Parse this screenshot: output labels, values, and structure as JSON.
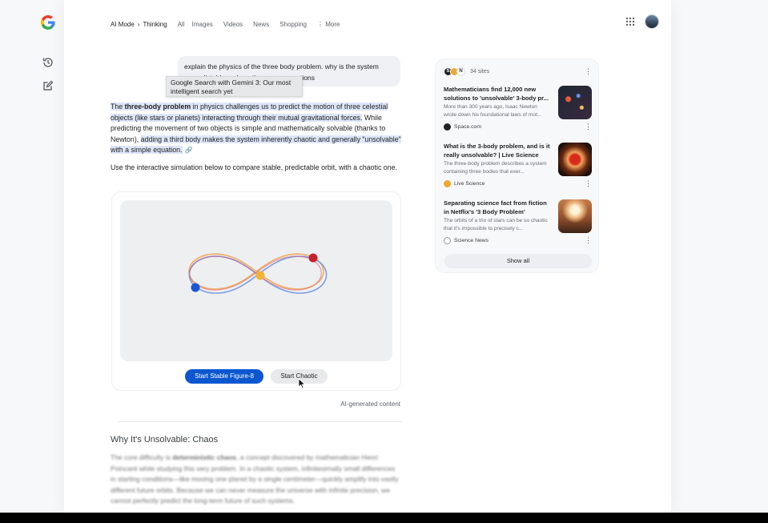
{
  "nav": {
    "crumb_mode": "AI Mode",
    "crumb_sep": "›",
    "crumb_current": "Thinking",
    "tabs": [
      "All",
      "Images",
      "Videos",
      "News",
      "Shopping"
    ],
    "more_label": "More"
  },
  "query": {
    "text_line1": "explain the physics of the three body problem. why is the system",
    "text_line2": "unpredictable and are there any exceptions"
  },
  "tooltip": {
    "line1": "Google Search with Gemini 3: Our most",
    "line2": "intelligent search yet"
  },
  "answer": {
    "p1_a": "The ",
    "p1_bold": "three-body problem",
    "p1_b": " in physics challenges us to predict the motion of three celestial objects (like stars or planets) interacting through their mutual gravitational forces.",
    "p1_c": " While predicting the movement of two objects is simple and mathematically solvable (thanks to Newton), ",
    "p1_d": "adding a third body makes the system inherently chaotic and generally \"unsolvable\" with a simple equation.",
    "intro": "Use the interactive simulation below to compare stable, predictable orbit, with a chaotic one."
  },
  "simulation": {
    "stable_button": "Start Stable Figure-8",
    "chaotic_button": "Start Chaotic",
    "body_colors": [
      "#1a56d6",
      "#f2b233",
      "#c5222d"
    ],
    "path_colors": [
      "#f0a24a",
      "#6a8fe0",
      "#e06070"
    ]
  },
  "ai_note": "AI-generated content",
  "section": {
    "title": "Why It's Unsolvable: Chaos",
    "body_a": "The core difficulty is ",
    "body_bold": "deterministic chaos",
    "body_b": ", a concept discovered by mathematician Henri Poincaré while studying this very problem. In a chaotic system, infinitesimally small differences in starting conditions—like moving one planet by a single centimeter—quickly amplify into vastly different future orbits. Because we can never measure the universe with infinite precision, we cannot perfectly predict the long-term future of such systems."
  },
  "sources": {
    "count_label": "34 sites",
    "items": [
      {
        "title": "Mathematicians find 12,000 new solutions to 'unsolvable' 3-body pr...",
        "snippet": "More than 300 years ago, Isaac Newton wrote down his foundational laws of mot...",
        "site": "Space.com"
      },
      {
        "title": "What is the 3-body problem, and is it really unsolvable? | Live Science",
        "snippet": "The three-body problem describes a system containing three bodies that exer...",
        "site": "Live Science"
      },
      {
        "title": "Separating science fact from fiction in Netflix's '3 Body Problem'",
        "snippet": "The orbits of a trio of stars can be so chaotic that it's impossible to precisely c...",
        "site": "Science News"
      }
    ],
    "show_all": "Show all"
  },
  "colors": {
    "accent": "#0b57d0",
    "highlight": "#dde6f8"
  }
}
